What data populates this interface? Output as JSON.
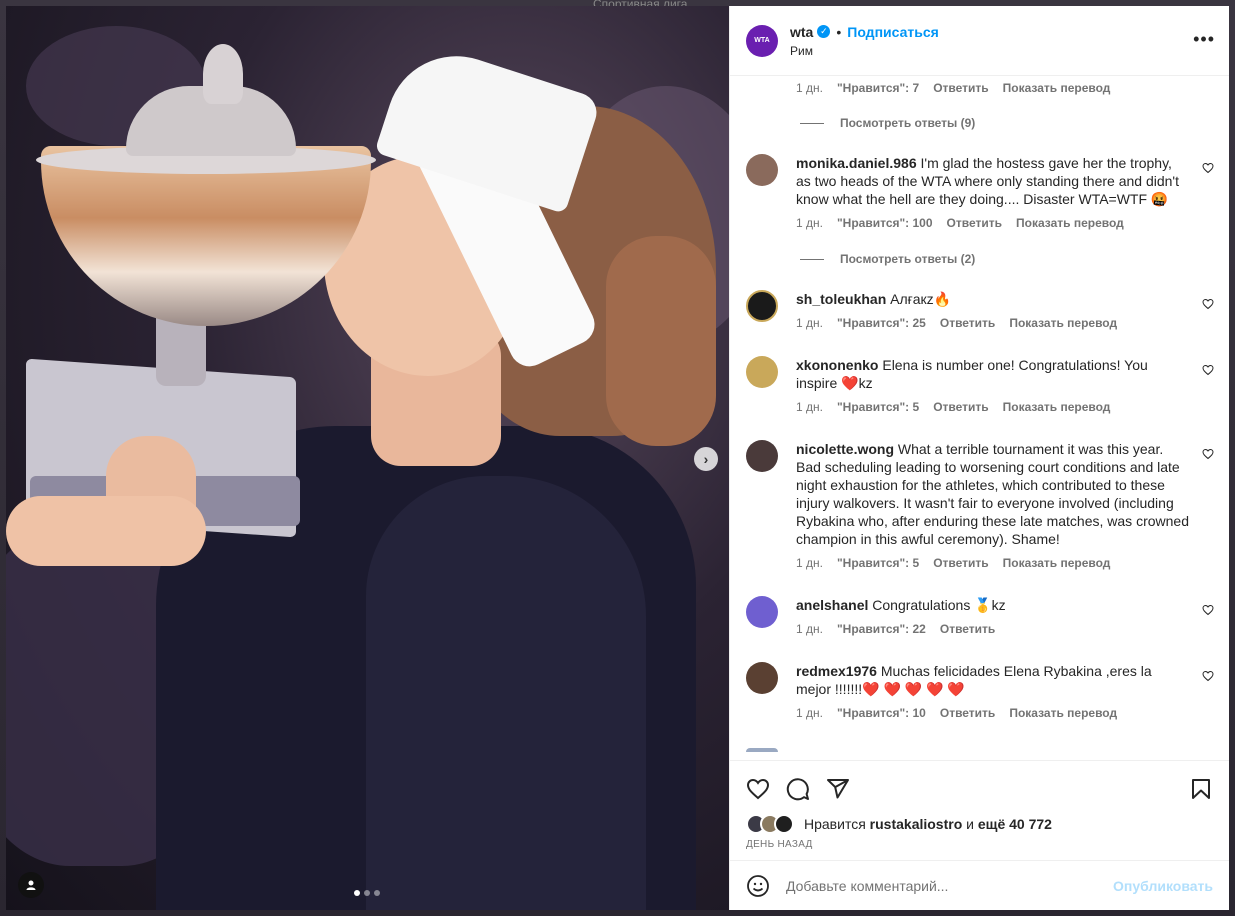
{
  "backdrop": {
    "top_text": "Спортивная лига"
  },
  "photo": {
    "carousel_total": 3,
    "carousel_active": 1
  },
  "header": {
    "username": "wta",
    "avatar_text": "WTA",
    "separator": "•",
    "follow_label": "Подписаться",
    "location": "Рим"
  },
  "comments_section": {
    "top_meta": {
      "time": "1 дн.",
      "likes": "\"Нравится\": 7",
      "reply": "Ответить",
      "translate": "Показать перевод"
    },
    "view_replies_1": "Посмотреть ответы (9)",
    "view_replies_2": "Посмотреть ответы (2)",
    "items": [
      {
        "user": "monika.daniel.986",
        "text": "I'm glad the hostess gave her the trophy, as two heads of the WTA where only standing there and didn't know what the hell are they doing.... Disaster WTA=WTF 🤬",
        "time": "1 дн.",
        "likes": "\"Нравится\": 100",
        "reply": "Ответить",
        "translate": "Показать перевод",
        "avatar_color": "#8a6a5c"
      },
      {
        "user": "sh_toleukhan",
        "text": "Алғакz🔥",
        "time": "1 дн.",
        "likes": "\"Нравится\": 25",
        "reply": "Ответить",
        "translate": "Показать перевод",
        "avatar_color": "#1a1a1a"
      },
      {
        "user": "xkononenko",
        "text": "Elena is number one! Congratulations! You inspire ❤️kz",
        "time": "1 дн.",
        "likes": "\"Нравится\": 5",
        "reply": "Ответить",
        "translate": "Показать перевод",
        "avatar_color": "#c9a85a"
      },
      {
        "user": "nicolette.wong",
        "text": "What a terrible tournament it was this year. Bad scheduling leading to worsening court conditions and late night exhaustion for the athletes, which contributed to these injury walkovers. It wasn't fair to everyone involved (including Rybakina who, after enduring these late matches, was crowned champion in this awful ceremony). Shame!",
        "time": "1 дн.",
        "likes": "\"Нравится\": 5",
        "reply": "Ответить",
        "translate": "Показать перевод",
        "avatar_color": "#4a3a3a"
      },
      {
        "user": "anelshanel",
        "text": "Congratulations 🥇kz",
        "time": "1 дн.",
        "likes": "\"Нравится\": 22",
        "reply": "Ответить",
        "translate": "",
        "avatar_color": "#6f5fd0"
      },
      {
        "user": "redmex1976",
        "text": "Muchas felicidades Elena Rybakina ,eres la mejor !!!!!!!❤️ ❤️ ❤️ ❤️ ❤️",
        "time": "1 дн.",
        "likes": "\"Нравится\": 10",
        "reply": "Ответить",
        "translate": "Показать перевод",
        "avatar_color": "#5a4032"
      }
    ]
  },
  "actions": {
    "liked_by_prefix": "Нравится",
    "liked_by_user": "rustakaliostro",
    "liked_by_and": "и",
    "liked_by_others": "ещё 40 772",
    "date": "ДЕНЬ НАЗАД",
    "comment_placeholder": "Добавьте комментарий...",
    "publish_label": "Опубликовать"
  },
  "colors": {
    "accent": "#0095f6",
    "brand": "#6a1fb0",
    "muted": "#737373",
    "heart_red": "#ed4956"
  }
}
